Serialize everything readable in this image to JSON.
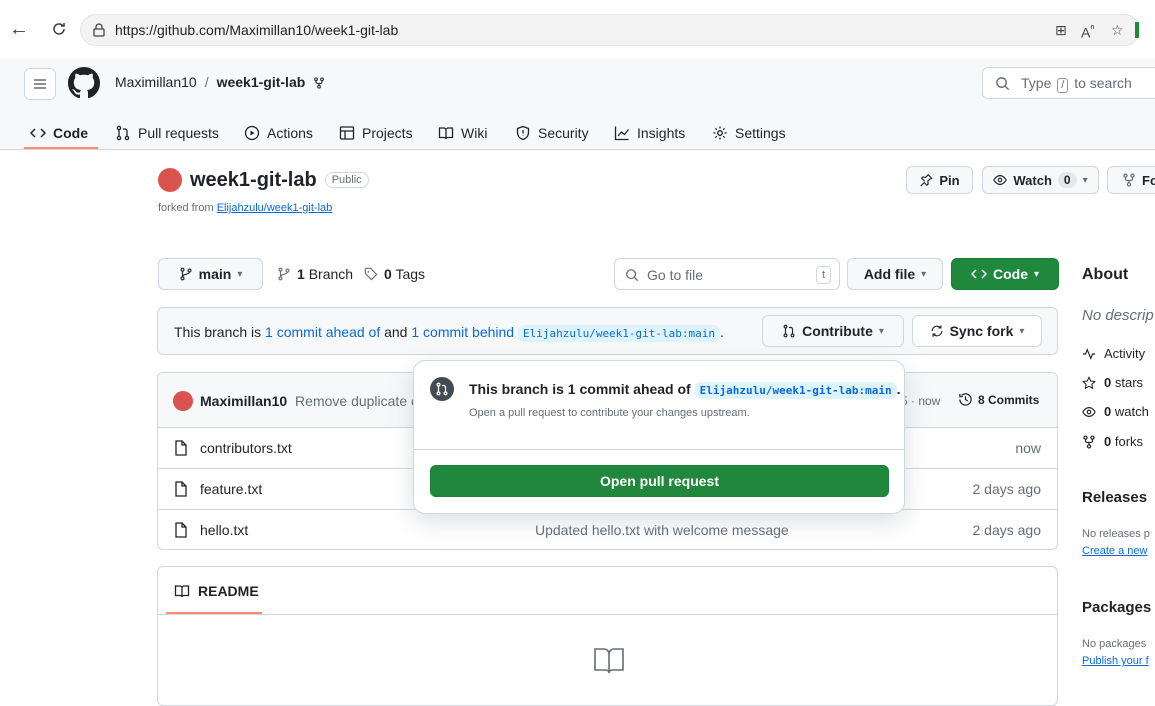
{
  "browser": {
    "url": "https://github.com/Maximillan10/week1-git-lab"
  },
  "header": {
    "owner": "Maximillan10",
    "separator": "/",
    "repo": "week1-git-lab",
    "search_prefix": "Type",
    "search_key": "/",
    "search_suffix": "to search"
  },
  "tabs": [
    {
      "label": "Code",
      "icon": "code-icon"
    },
    {
      "label": "Pull requests",
      "icon": "pull-request-icon"
    },
    {
      "label": "Actions",
      "icon": "play-icon"
    },
    {
      "label": "Projects",
      "icon": "table-icon"
    },
    {
      "label": "Wiki",
      "icon": "book-icon"
    },
    {
      "label": "Security",
      "icon": "shield-icon"
    },
    {
      "label": "Insights",
      "icon": "graph-icon"
    },
    {
      "label": "Settings",
      "icon": "gear-icon"
    }
  ],
  "repo": {
    "name": "week1-git-lab",
    "visibility": "Public",
    "forked_prefix": "forked from",
    "forked_from": "Elijahzulu/week1-git-lab",
    "pin_label": "Pin",
    "watch_label": "Watch",
    "watch_count": "0",
    "fork_label": "Fo"
  },
  "branch_bar": {
    "branch": "main",
    "branch_count": "1",
    "branch_label": "Branch",
    "tag_count": "0",
    "tag_label": "Tags",
    "go_to_file": "Go to file",
    "go_to_file_key": "t",
    "add_file": "Add file",
    "code": "Code"
  },
  "status": {
    "prefix": "This branch is",
    "ahead": "1 commit ahead of",
    "and": "and",
    "behind": "1 commit behind",
    "upstream": "Elijahzulu/week1-git-lab:main",
    "period": ".",
    "contribute": "Contribute",
    "sync_fork": "Sync fork"
  },
  "commit": {
    "author": "Maximillan10",
    "message": "Remove duplicate e",
    "time": "5 · now",
    "commits": "8 Commits"
  },
  "files": [
    {
      "name": "contributors.txt",
      "message": "",
      "time": "now"
    },
    {
      "name": "feature.txt",
      "message": "",
      "time": "2 days ago"
    },
    {
      "name": "hello.txt",
      "message": "Updated hello.txt with welcome message",
      "time": "2 days ago"
    }
  ],
  "readme": {
    "label": "README"
  },
  "popup": {
    "title_prefix": "This branch is 1 commit ahead of",
    "title_ref": "Elijahzulu/week1-git-lab:main",
    "title_suffix": ".",
    "description": "Open a pull request to contribute your changes upstream.",
    "button": "Open pull request"
  },
  "sidebar": {
    "about": "About",
    "description": "No descrip",
    "activity": "Activity",
    "stars_count": "0",
    "stars": "stars",
    "watch_count": "0",
    "watch": "watch",
    "forks_count": "0",
    "forks": "forks",
    "releases": "Releases",
    "releases_none": "No releases p",
    "releases_link": "Create a new",
    "packages": "Packages",
    "packages_none": "No packages",
    "packages_link": "Publish your f"
  },
  "colors": {
    "primary_green": "#1f883d",
    "link_blue": "#0969da",
    "tab_underline": "#fd8c73"
  }
}
